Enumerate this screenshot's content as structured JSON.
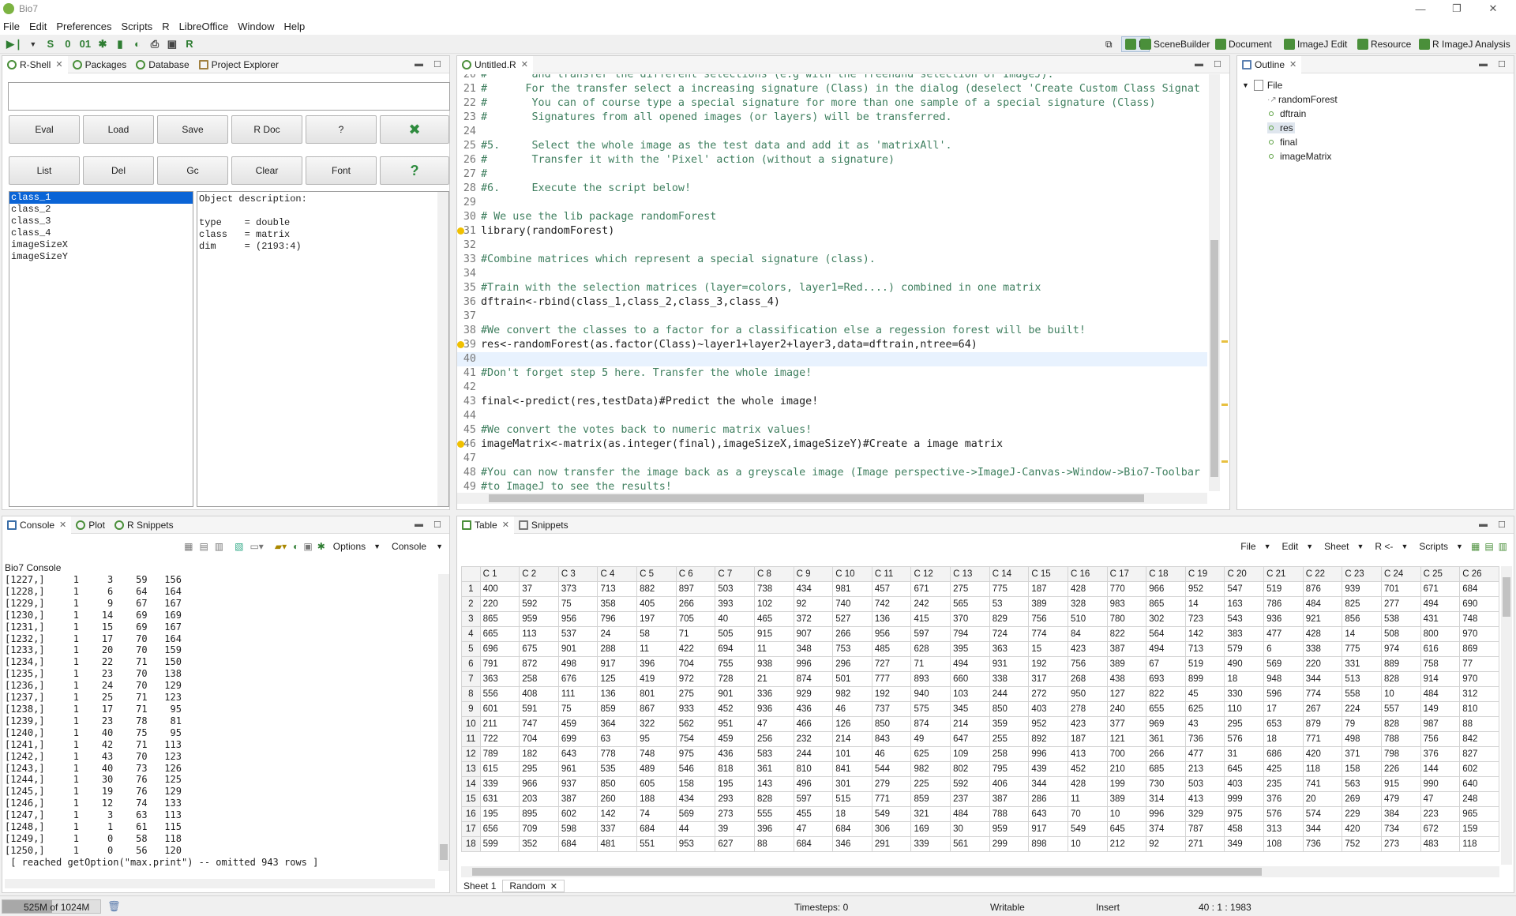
{
  "window": {
    "title": "Bio7",
    "minimize": "—",
    "restore": "❐",
    "close": "✕"
  },
  "menu": [
    "File",
    "Edit",
    "Preferences",
    "Scripts",
    "R",
    "LibreOffice",
    "Window",
    "Help"
  ],
  "perspectives": [
    "R",
    "SceneBuilder",
    "Document",
    "ImageJ Edit",
    "Resource",
    "R ImageJ Analysis"
  ],
  "rshell": {
    "tabs": [
      "R-Shell",
      "Packages",
      "Database",
      "Project Explorer"
    ],
    "input_value": "",
    "buttons_row1": [
      "Eval",
      "Load",
      "Save",
      "R Doc",
      "?",
      "✖"
    ],
    "buttons_row2": [
      "List",
      "Del",
      "Gc",
      "Clear",
      "Font",
      "?"
    ],
    "objects": [
      "class_1",
      "class_2",
      "class_3",
      "class_4",
      "imageSizeX",
      "imageSizeY"
    ],
    "description": "Object description:\n\ntype    = double\nclass   = matrix\ndim     = (2193:4)"
  },
  "editor": {
    "tab": "Untitled.R",
    "lines": [
      {
        "n": "20",
        "t": "#       and transfer the different selections (e.g with the freehand selection of ImageJ).",
        "c": true,
        "w": false
      },
      {
        "n": "21",
        "t": "#      For the transfer select a increasing signature (Class) in the dialog (deselect 'Create Custom Class Signat",
        "c": true,
        "w": false
      },
      {
        "n": "22",
        "t": "#       You can of course type a special signature for more than one sample of a special signature (Class)",
        "c": true,
        "w": false
      },
      {
        "n": "23",
        "t": "#       Signatures from all opened images (or layers) will be transferred.",
        "c": true,
        "w": false
      },
      {
        "n": "24",
        "t": "",
        "c": false,
        "w": false
      },
      {
        "n": "25",
        "t": "#5.     Select the whole image as the test data and add it as 'matrixAll'.",
        "c": true,
        "w": false
      },
      {
        "n": "26",
        "t": "#       Transfer it with the 'Pixel' action (without a signature)",
        "c": true,
        "w": false
      },
      {
        "n": "27",
        "t": "#",
        "c": true,
        "w": false
      },
      {
        "n": "28",
        "t": "#6.     Execute the script below!",
        "c": true,
        "w": false
      },
      {
        "n": "29",
        "t": "",
        "c": false,
        "w": false
      },
      {
        "n": "30",
        "t": "# We use the lib package randomForest",
        "c": true,
        "w": false
      },
      {
        "n": "31",
        "t": "library(randomForest)",
        "c": false,
        "w": true
      },
      {
        "n": "32",
        "t": "",
        "c": false,
        "w": false
      },
      {
        "n": "33",
        "t": "#Combine matrices which represent a special signature (class).",
        "c": true,
        "w": false
      },
      {
        "n": "34",
        "t": "",
        "c": false,
        "w": false
      },
      {
        "n": "35",
        "t": "#Train with the selection matrices (layer=colors, layer1=Red....) combined in one matrix",
        "c": true,
        "w": false
      },
      {
        "n": "36",
        "t": "dftrain<-rbind(class_1,class_2,class_3,class_4)",
        "c": false,
        "w": false
      },
      {
        "n": "37",
        "t": "",
        "c": false,
        "w": false
      },
      {
        "n": "38",
        "t": "#We convert the classes to a factor for a classification else a regession forest will be built!",
        "c": true,
        "w": false
      },
      {
        "n": "39",
        "t": "res<-randomForest(as.factor(Class)~layer1+layer2+layer3,data=dftrain,ntree=64)",
        "c": false,
        "w": true
      },
      {
        "n": "40",
        "t": "",
        "c": false,
        "w": false
      },
      {
        "n": "41",
        "t": "#Don't forget step 5 here. Transfer the whole image!",
        "c": true,
        "w": false
      },
      {
        "n": "42",
        "t": "",
        "c": false,
        "w": false
      },
      {
        "n": "43",
        "t": "final<-predict(res,testData)#Predict the whole image!",
        "c": false,
        "w": false
      },
      {
        "n": "44",
        "t": "",
        "c": false,
        "w": false
      },
      {
        "n": "45",
        "t": "#We convert the votes back to numeric matrix values!",
        "c": true,
        "w": false
      },
      {
        "n": "46",
        "t": "imageMatrix<-matrix(as.integer(final),imageSizeX,imageSizeY)#Create a image matrix",
        "c": false,
        "w": true
      },
      {
        "n": "47",
        "t": "",
        "c": false,
        "w": false
      },
      {
        "n": "48",
        "t": "#You can now transfer the image back as a greyscale image (Image perspective->ImageJ-Canvas->Window->Bio7-Toolbar",
        "c": true,
        "w": false
      },
      {
        "n": "49",
        "t": "#to ImageJ to see the results!",
        "c": true,
        "w": false
      }
    ]
  },
  "outline": {
    "tab": "Outline",
    "root": "File",
    "items": [
      "randomForest",
      "dftrain",
      "res",
      "final",
      "imageMatrix"
    ]
  },
  "console": {
    "tabs": [
      "Console",
      "Plot",
      "R Snippets"
    ],
    "label": "Bio7 Console",
    "toolbar": [
      "Options",
      "Console"
    ],
    "lines": [
      "[1227,]     1     3    59   156",
      "[1228,]     1     6    64   164",
      "[1229,]     1     9    67   167",
      "[1230,]     1    14    69   169",
      "[1231,]     1    15    69   167",
      "[1232,]     1    17    70   164",
      "[1233,]     1    20    70   159",
      "[1234,]     1    22    71   150",
      "[1235,]     1    23    70   138",
      "[1236,]     1    24    70   129",
      "[1237,]     1    25    71   123",
      "[1238,]     1    17    71    95",
      "[1239,]     1    23    78    81",
      "[1240,]     1    40    75    95",
      "[1241,]     1    42    71   113",
      "[1242,]     1    43    70   123",
      "[1243,]     1    40    73   126",
      "[1244,]     1    30    76   125",
      "[1245,]     1    19    76   129",
      "[1246,]     1    12    74   133",
      "[1247,]     1     3    63   113",
      "[1248,]     1     1    61   115",
      "[1249,]     1     0    58   118",
      "[1250,]     1     0    56   120",
      " [ reached getOption(\"max.print\") -- omitted 943 rows ]"
    ]
  },
  "table": {
    "tabs": [
      "Table",
      "Snippets"
    ],
    "menus": [
      "File",
      "Edit",
      "Sheet",
      "R <-",
      "Scripts"
    ],
    "headers": [
      "C 1",
      "C 2",
      "C 3",
      "C 4",
      "C 5",
      "C 6",
      "C 7",
      "C 8",
      "C 9",
      "C 10",
      "C 11",
      "C 12",
      "C 13",
      "C 14",
      "C 15",
      "C 16",
      "C 17",
      "C 18",
      "C 19",
      "C 20",
      "C 21",
      "C 22",
      "C 23",
      "C 24",
      "C 25",
      "C 26"
    ],
    "rows": [
      [
        "1",
        "400",
        "37",
        "373",
        "713",
        "882",
        "897",
        "503",
        "738",
        "434",
        "981",
        "457",
        "671",
        "275",
        "775",
        "187",
        "428",
        "770",
        "966",
        "952",
        "547",
        "519",
        "876",
        "939",
        "701",
        "671",
        "684"
      ],
      [
        "2",
        "220",
        "592",
        "75",
        "358",
        "405",
        "266",
        "393",
        "102",
        "92",
        "740",
        "742",
        "242",
        "565",
        "53",
        "389",
        "328",
        "983",
        "865",
        "14",
        "163",
        "786",
        "484",
        "825",
        "277",
        "494",
        "690"
      ],
      [
        "3",
        "865",
        "959",
        "956",
        "796",
        "197",
        "705",
        "40",
        "465",
        "372",
        "527",
        "136",
        "415",
        "370",
        "829",
        "756",
        "510",
        "780",
        "302",
        "723",
        "543",
        "936",
        "921",
        "856",
        "538",
        "431",
        "748"
      ],
      [
        "4",
        "665",
        "113",
        "537",
        "24",
        "58",
        "71",
        "505",
        "915",
        "907",
        "266",
        "956",
        "597",
        "794",
        "724",
        "774",
        "84",
        "822",
        "564",
        "142",
        "383",
        "477",
        "428",
        "14",
        "508",
        "800",
        "970"
      ],
      [
        "5",
        "696",
        "675",
        "901",
        "288",
        "11",
        "422",
        "694",
        "11",
        "348",
        "753",
        "485",
        "628",
        "395",
        "363",
        "15",
        "423",
        "387",
        "494",
        "713",
        "579",
        "6",
        "338",
        "775",
        "974",
        "616",
        "869"
      ],
      [
        "6",
        "791",
        "872",
        "498",
        "917",
        "396",
        "704",
        "755",
        "938",
        "996",
        "296",
        "727",
        "71",
        "494",
        "931",
        "192",
        "756",
        "389",
        "67",
        "519",
        "490",
        "569",
        "220",
        "331",
        "889",
        "758",
        "77"
      ],
      [
        "7",
        "363",
        "258",
        "676",
        "125",
        "419",
        "972",
        "728",
        "21",
        "874",
        "501",
        "777",
        "893",
        "660",
        "338",
        "317",
        "268",
        "438",
        "693",
        "899",
        "18",
        "948",
        "344",
        "513",
        "828",
        "914",
        "970"
      ],
      [
        "8",
        "556",
        "408",
        "111",
        "136",
        "801",
        "275",
        "901",
        "336",
        "929",
        "982",
        "192",
        "940",
        "103",
        "244",
        "272",
        "950",
        "127",
        "822",
        "45",
        "330",
        "596",
        "774",
        "558",
        "10",
        "484",
        "312"
      ],
      [
        "9",
        "601",
        "591",
        "75",
        "859",
        "867",
        "933",
        "452",
        "936",
        "436",
        "46",
        "737",
        "575",
        "345",
        "850",
        "403",
        "278",
        "240",
        "655",
        "625",
        "110",
        "17",
        "267",
        "224",
        "557",
        "149",
        "810"
      ],
      [
        "10",
        "211",
        "747",
        "459",
        "364",
        "322",
        "562",
        "951",
        "47",
        "466",
        "126",
        "850",
        "874",
        "214",
        "359",
        "952",
        "423",
        "377",
        "969",
        "43",
        "295",
        "653",
        "879",
        "79",
        "828",
        "987",
        "88"
      ],
      [
        "11",
        "722",
        "704",
        "699",
        "63",
        "95",
        "754",
        "459",
        "256",
        "232",
        "214",
        "843",
        "49",
        "647",
        "255",
        "892",
        "187",
        "121",
        "361",
        "736",
        "576",
        "18",
        "771",
        "498",
        "788",
        "756",
        "842"
      ],
      [
        "12",
        "789",
        "182",
        "643",
        "778",
        "748",
        "975",
        "436",
        "583",
        "244",
        "101",
        "46",
        "625",
        "109",
        "258",
        "996",
        "413",
        "700",
        "266",
        "477",
        "31",
        "686",
        "420",
        "371",
        "798",
        "376",
        "827"
      ],
      [
        "13",
        "615",
        "295",
        "961",
        "535",
        "489",
        "546",
        "818",
        "361",
        "810",
        "841",
        "544",
        "982",
        "802",
        "795",
        "439",
        "452",
        "210",
        "685",
        "213",
        "645",
        "425",
        "118",
        "158",
        "226",
        "144",
        "602"
      ],
      [
        "14",
        "339",
        "966",
        "937",
        "850",
        "605",
        "158",
        "195",
        "143",
        "496",
        "301",
        "279",
        "225",
        "592",
        "406",
        "344",
        "428",
        "199",
        "730",
        "503",
        "403",
        "235",
        "741",
        "563",
        "915",
        "990",
        "640"
      ],
      [
        "15",
        "631",
        "203",
        "387",
        "260",
        "188",
        "434",
        "293",
        "828",
        "597",
        "515",
        "771",
        "859",
        "237",
        "387",
        "286",
        "11",
        "389",
        "314",
        "413",
        "999",
        "376",
        "20",
        "269",
        "479",
        "47",
        "248"
      ],
      [
        "16",
        "195",
        "895",
        "602",
        "142",
        "74",
        "569",
        "273",
        "555",
        "455",
        "18",
        "549",
        "321",
        "484",
        "788",
        "643",
        "70",
        "10",
        "996",
        "329",
        "975",
        "576",
        "574",
        "229",
        "384",
        "223",
        "965"
      ],
      [
        "17",
        "656",
        "709",
        "598",
        "337",
        "684",
        "44",
        "39",
        "396",
        "47",
        "684",
        "306",
        "169",
        "30",
        "959",
        "917",
        "549",
        "645",
        "374",
        "787",
        "458",
        "313",
        "344",
        "420",
        "734",
        "672",
        "159"
      ],
      [
        "18",
        "599",
        "352",
        "684",
        "481",
        "551",
        "953",
        "627",
        "88",
        "684",
        "346",
        "291",
        "339",
        "561",
        "299",
        "898",
        "10",
        "212",
        "92",
        "271",
        "349",
        "108",
        "736",
        "752",
        "273",
        "483",
        "118"
      ]
    ],
    "sheets": [
      "Sheet 1",
      "Random"
    ]
  },
  "status": {
    "memory": "525M of 1024M",
    "memory_fraction": 0.51,
    "timesteps": "Timesteps: 0",
    "writable": "Writable",
    "insert": "Insert",
    "position": "40 : 1 : 1983"
  }
}
